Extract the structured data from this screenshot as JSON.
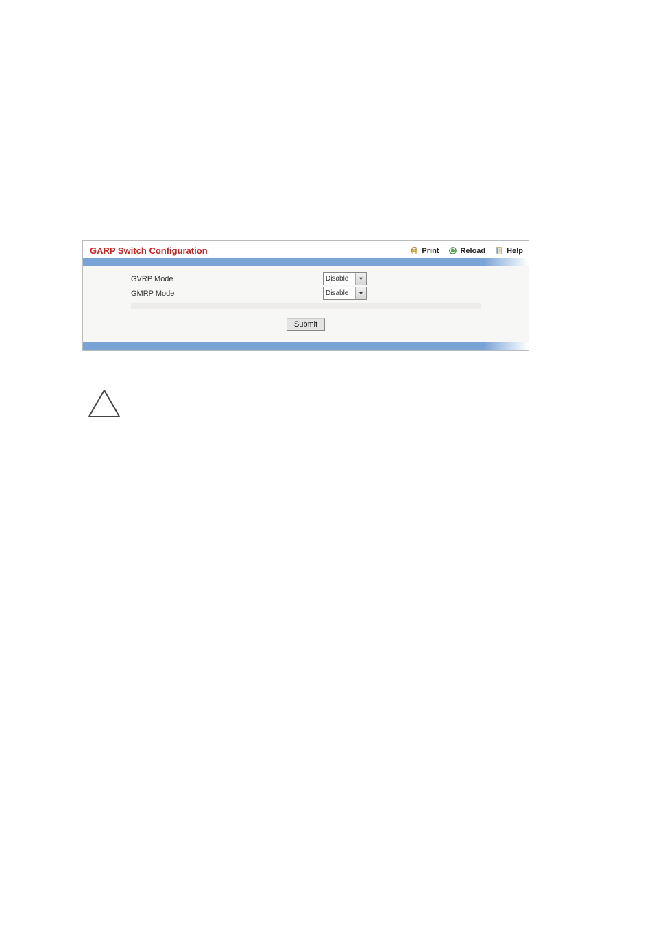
{
  "panel": {
    "title": "GARP Switch Configuration",
    "tools": {
      "print_label": "Print",
      "reload_label": "Reload",
      "help_label": "Help"
    }
  },
  "form": {
    "rows": [
      {
        "label": "GVRP Mode",
        "value": "Disable"
      },
      {
        "label": "GMRP Mode",
        "value": "Disable"
      }
    ],
    "submit_label": "Submit"
  }
}
